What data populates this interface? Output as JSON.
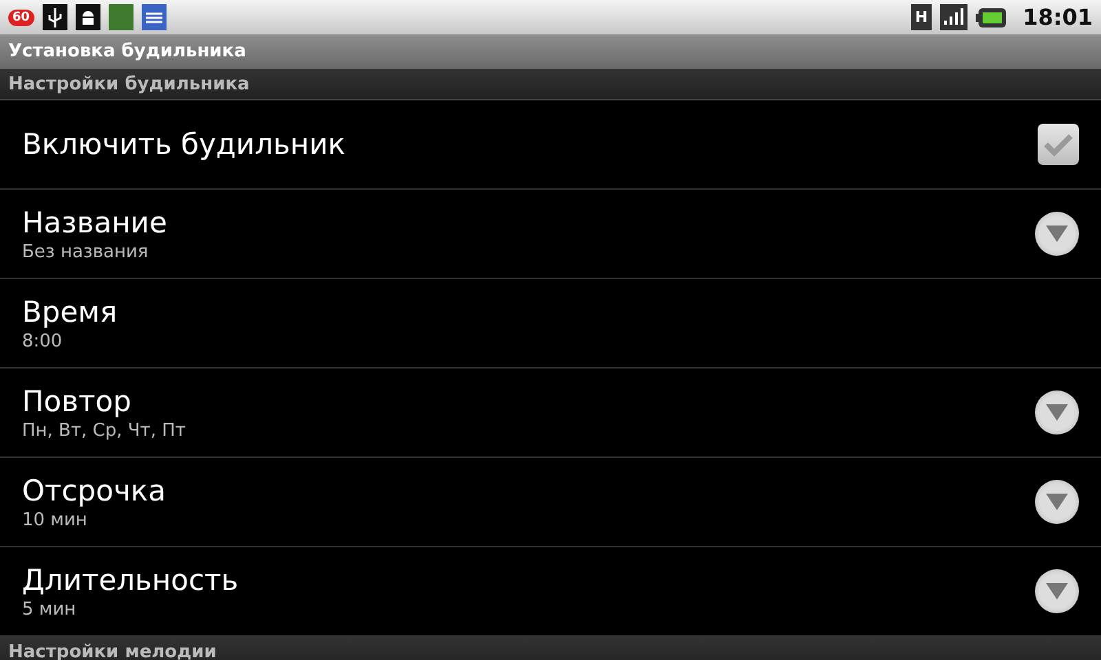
{
  "status_bar": {
    "notification_badge": "60",
    "time": "18:01",
    "network_type": "H"
  },
  "window": {
    "title": "Установка будильника"
  },
  "sections": [
    {
      "title": "Настройки будильника",
      "items": [
        {
          "kind": "checkbox",
          "title": "Включить будильник",
          "checked": true
        },
        {
          "kind": "dropdown",
          "title": "Название",
          "summary": "Без названия"
        },
        {
          "kind": "plain",
          "title": "Время",
          "summary": "8:00"
        },
        {
          "kind": "dropdown",
          "title": "Повтор",
          "summary": "Пн, Вт, Ср, Чт, Пт"
        },
        {
          "kind": "dropdown",
          "title": "Отсрочка",
          "summary": "10 мин"
        },
        {
          "kind": "dropdown",
          "title": "Длительность",
          "summary": "5 мин"
        }
      ]
    },
    {
      "title": "Настройки мелодии"
    }
  ]
}
